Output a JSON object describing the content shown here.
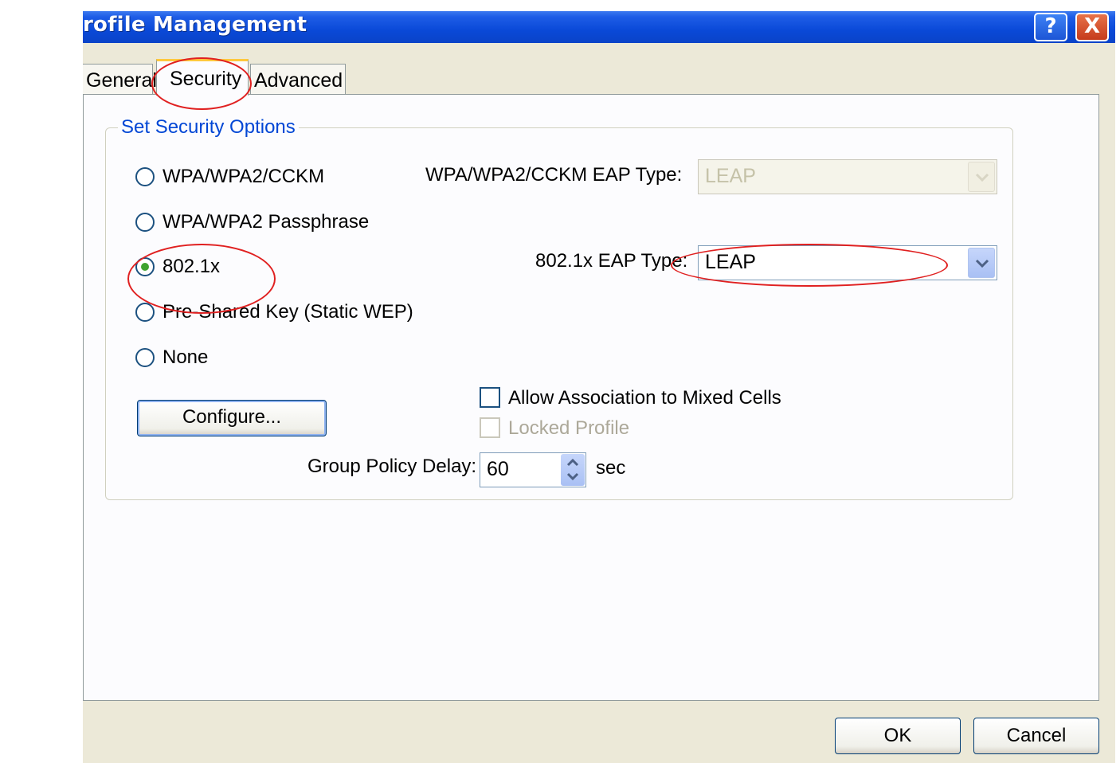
{
  "window": {
    "title": "rofile Management"
  },
  "title_buttons": {
    "help": "?",
    "close": "X"
  },
  "tabs": [
    {
      "label": "General",
      "selected": false
    },
    {
      "label": "Security",
      "selected": true
    },
    {
      "label": "Advanced",
      "selected": false
    }
  ],
  "security": {
    "group_title": "Set Security Options",
    "options": [
      {
        "label": "WPA/WPA2/CCKM",
        "selected": false
      },
      {
        "label": "WPA/WPA2 Passphrase",
        "selected": false
      },
      {
        "label": "802.1x",
        "selected": true
      },
      {
        "label": "Pre-Shared Key (Static WEP)",
        "selected": false
      },
      {
        "label": "None",
        "selected": false
      }
    ],
    "wpa_eap_label": "WPA/WPA2/CCKM EAP Type:",
    "wpa_eap_value": "LEAP",
    "dot1x_eap_label": "802.1x EAP Type:",
    "dot1x_eap_value": "LEAP",
    "configure_label": "Configure...",
    "allow_mixed_label": "Allow Association to Mixed Cells",
    "allow_mixed_checked": false,
    "locked_profile_label": "Locked Profile",
    "locked_profile_checked": false,
    "group_policy_label": "Group Policy Delay:",
    "group_policy_value": "60",
    "group_policy_unit": "sec"
  },
  "footer": {
    "ok_label": "OK",
    "cancel_label": "Cancel"
  },
  "colors": {
    "titlebar": "#0a49d8",
    "group_title": "#0046d5",
    "annotation": "#e02020",
    "radio_dot": "#3fa32f"
  }
}
